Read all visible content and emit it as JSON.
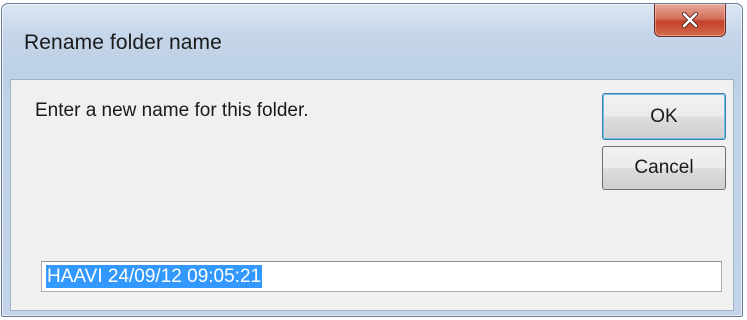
{
  "window": {
    "title": "Rename folder name",
    "close_icon": "close-x-icon"
  },
  "dialog": {
    "prompt": "Enter a new name for this folder.",
    "ok_label": "OK",
    "cancel_label": "Cancel",
    "name_value": "HAAVI 24/09/12 09:05:21",
    "name_selected": true
  },
  "colors": {
    "selection": "#3399ff",
    "close_button": "#c3412b",
    "default_button_border": "#3c7fb1"
  }
}
